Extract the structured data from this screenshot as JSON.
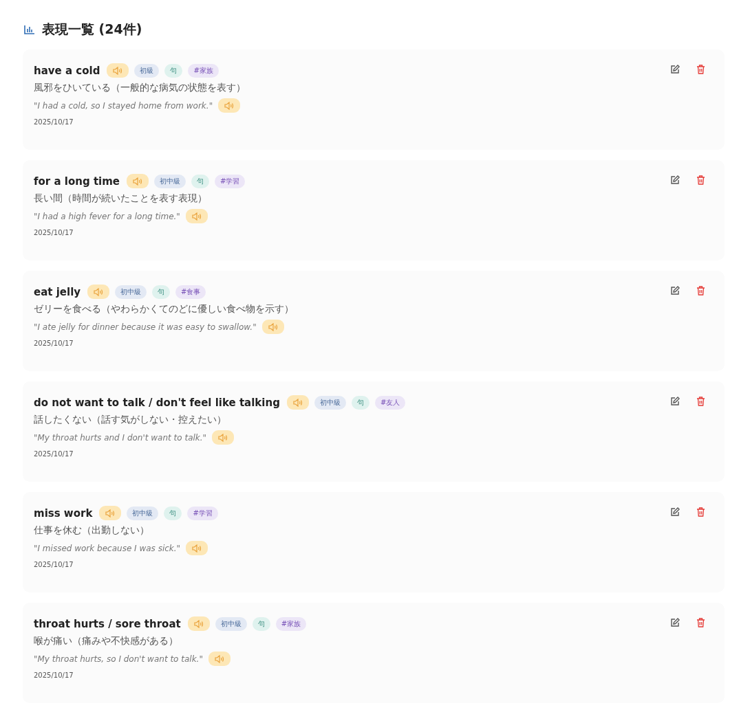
{
  "heading": "表現一覧 (24件)",
  "items": [
    {
      "phrase": "have a cold",
      "level": "初級",
      "type": "句",
      "tag": "#家族",
      "meaning": "風邪をひいている（一般的な病気の状態を表す）",
      "example": "\"I had a cold, so I stayed home from work.\"",
      "date": "2025/10/17"
    },
    {
      "phrase": "for a long time",
      "level": "初中級",
      "type": "句",
      "tag": "#学習",
      "meaning": "長い間（時間が続いたことを表す表現）",
      "example": "\"I had a high fever for a long time.\"",
      "date": "2025/10/17"
    },
    {
      "phrase": "eat jelly",
      "level": "初中級",
      "type": "句",
      "tag": "#食事",
      "meaning": "ゼリーを食べる（やわらかくてのどに優しい食べ物を示す）",
      "example": "\"I ate jelly for dinner because it was easy to swallow.\"",
      "date": "2025/10/17"
    },
    {
      "phrase": "do not want to talk / don't feel like talking",
      "level": "初中級",
      "type": "句",
      "tag": "#友人",
      "meaning": "話したくない（話す気がしない・控えたい）",
      "example": "\"My throat hurts and I don't want to talk.\"",
      "date": "2025/10/17"
    },
    {
      "phrase": "miss work",
      "level": "初中級",
      "type": "句",
      "tag": "#学習",
      "meaning": "仕事を休む（出勤しない）",
      "example": "\"I missed work because I was sick.\"",
      "date": "2025/10/17"
    },
    {
      "phrase": "throat hurts / sore throat",
      "level": "初中級",
      "type": "句",
      "tag": "#家族",
      "meaning": "喉が痛い（痛みや不快感がある）",
      "example": "\"My throat hurts, so I don't want to talk.\"",
      "date": "2025/10/17"
    }
  ]
}
